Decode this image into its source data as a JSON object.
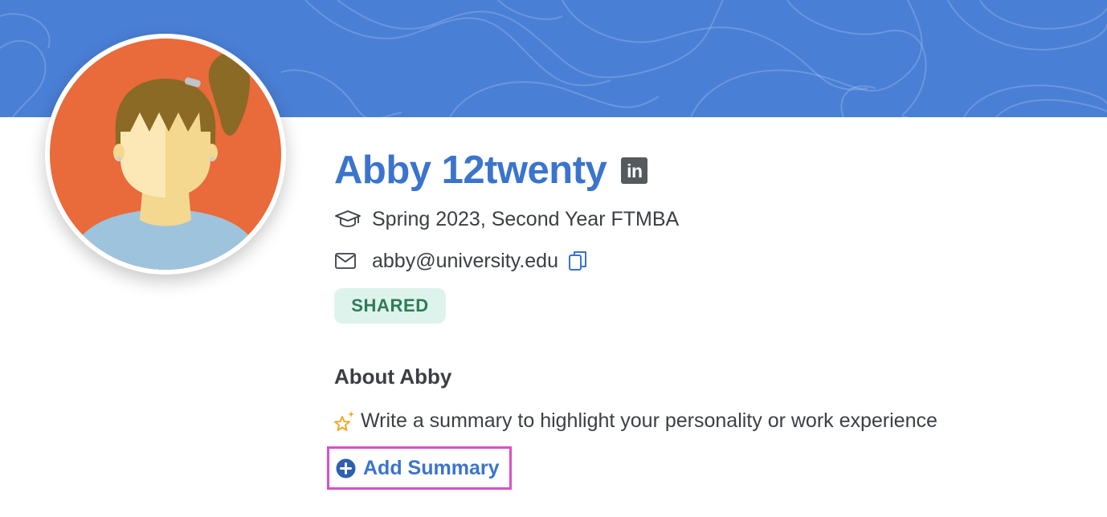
{
  "profile": {
    "name": "Abby 12twenty",
    "linkedin_label": "in",
    "program": "Spring 2023, Second Year FTMBA",
    "email": "abby@university.edu",
    "status_badge": "SHARED"
  },
  "about": {
    "title": "About Abby",
    "prompt": "Write a summary to highlight your personality or work experience",
    "add_summary_label": "Add Summary"
  },
  "icons": {
    "program": "graduation-cap-icon",
    "email": "envelope-icon",
    "copy": "copy-icon",
    "linkedin": "linkedin-icon",
    "prompt": "sparkle-star-icon",
    "add": "plus-circle-icon"
  },
  "colors": {
    "banner": "#4a7fd6",
    "accent": "#3b74cc",
    "badge_bg": "#ddf3ec",
    "badge_text": "#2f7a58",
    "highlight_border": "#d84fc7",
    "avatar_bg": "#e96a3a"
  }
}
